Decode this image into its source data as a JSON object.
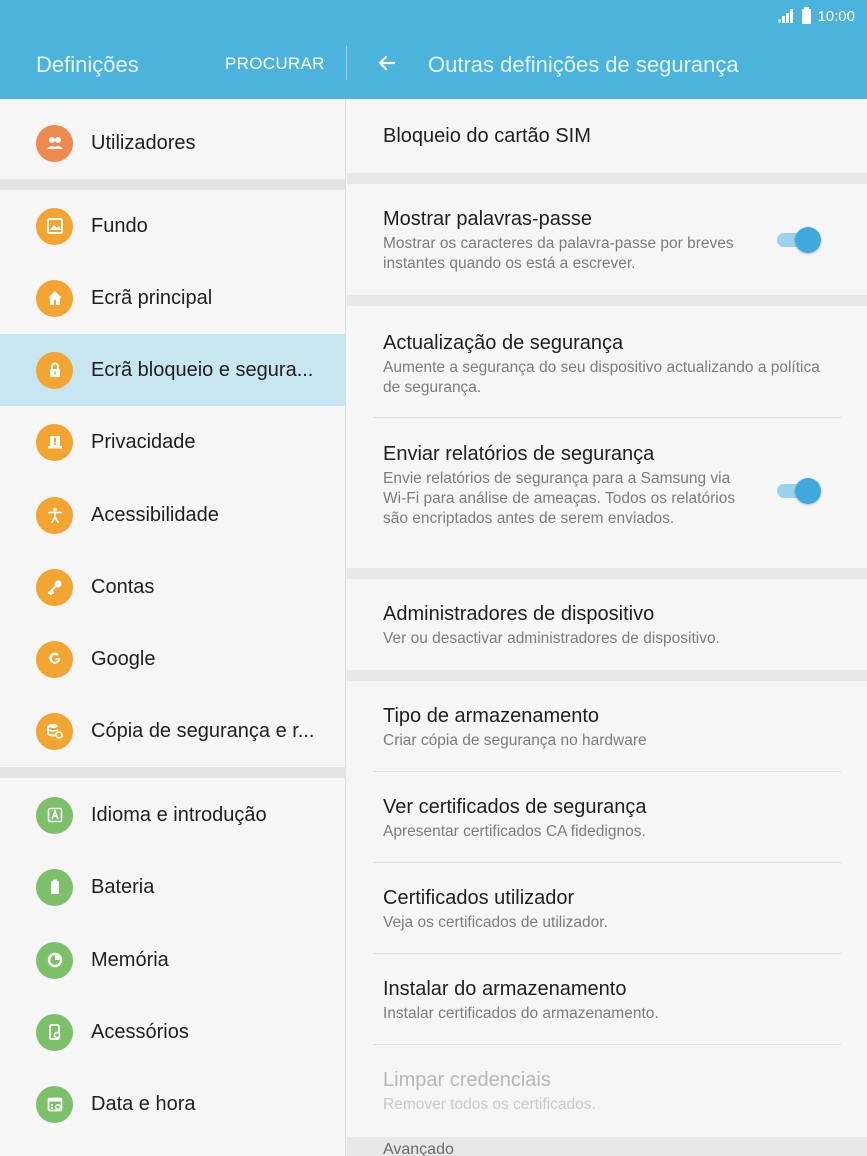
{
  "status_bar": {
    "time": "10:00"
  },
  "app_bar": {
    "left_title": "Definições",
    "search_label": "PROCURAR",
    "right_title": "Outras definições de segurança"
  },
  "sidebar": {
    "items": [
      {
        "label": "Utilizadores",
        "icon": "users-icon",
        "color": "#ef8a4f"
      },
      {
        "label": "Fundo",
        "icon": "wallpaper-icon",
        "color": "#f2a531"
      },
      {
        "label": "Ecrã principal",
        "icon": "home-icon",
        "color": "#f2a531"
      },
      {
        "label": "Ecrã bloqueio e segura...",
        "icon": "lock-icon",
        "color": "#f2a531",
        "selected": true
      },
      {
        "label": "Privacidade",
        "icon": "privacy-icon",
        "color": "#f2a531"
      },
      {
        "label": "Acessibilidade",
        "icon": "accessibility-icon",
        "color": "#f2a531"
      },
      {
        "label": "Contas",
        "icon": "key-icon",
        "color": "#f2a531"
      },
      {
        "label": "Google",
        "icon": "google-icon",
        "color": "#f2a531"
      },
      {
        "label": "Cópia de segurança e r...",
        "icon": "backup-icon",
        "color": "#f2a531"
      },
      {
        "label": "Idioma e introdução",
        "icon": "language-icon",
        "color": "#7cc06a"
      },
      {
        "label": "Bateria",
        "icon": "battery-icon",
        "color": "#7cc06a"
      },
      {
        "label": "Memória",
        "icon": "memory-icon",
        "color": "#7cc06a"
      },
      {
        "label": "Acessórios",
        "icon": "accessories-icon",
        "color": "#7cc06a"
      },
      {
        "label": "Data e hora",
        "icon": "calendar-icon",
        "color": "#7cc06a"
      }
    ]
  },
  "settings": {
    "sim_lock": {
      "title": "Bloqueio do cartão SIM"
    },
    "show_passwords": {
      "title": "Mostrar palavras-passe",
      "subtitle": "Mostrar os caracteres da palavra-passe por breves instantes quando os está a escrever.",
      "enabled": true
    },
    "security_update": {
      "title": "Actualização de segurança",
      "subtitle": "Aumente a segurança do seu dispositivo actualizando a política de segurança."
    },
    "send_reports": {
      "title": "Enviar relatórios de segurança",
      "subtitle": "Envie relatórios de segurança para a Samsung via Wi-Fi para análise de ameaças. Todos os relatórios são encriptados antes de serem enviados.",
      "enabled": true
    },
    "device_admins": {
      "title": "Administradores de dispositivo",
      "subtitle": "Ver ou desactivar administradores de dispositivo."
    },
    "storage_type": {
      "title": "Tipo de armazenamento",
      "subtitle": "Criar cópia de segurança no hardware"
    },
    "view_certs": {
      "title": "Ver certificados de segurança",
      "subtitle": "Apresentar certificados CA fidedignos."
    },
    "user_certs": {
      "title": "Certificados utilizador",
      "subtitle": "Veja os certificados de utilizador."
    },
    "install_storage": {
      "title": "Instalar do armazenamento",
      "subtitle": "Instalar certificados do armazenamento."
    },
    "clear_credentials": {
      "title": "Limpar credenciais",
      "subtitle": "Remover todos os certificados.",
      "disabled": true
    },
    "advanced_header": "Avançado"
  },
  "colors": {
    "app_bar": "#4cb3dc",
    "selected_item": "#c8e6f1",
    "toggle_on": "#3fa9de"
  }
}
